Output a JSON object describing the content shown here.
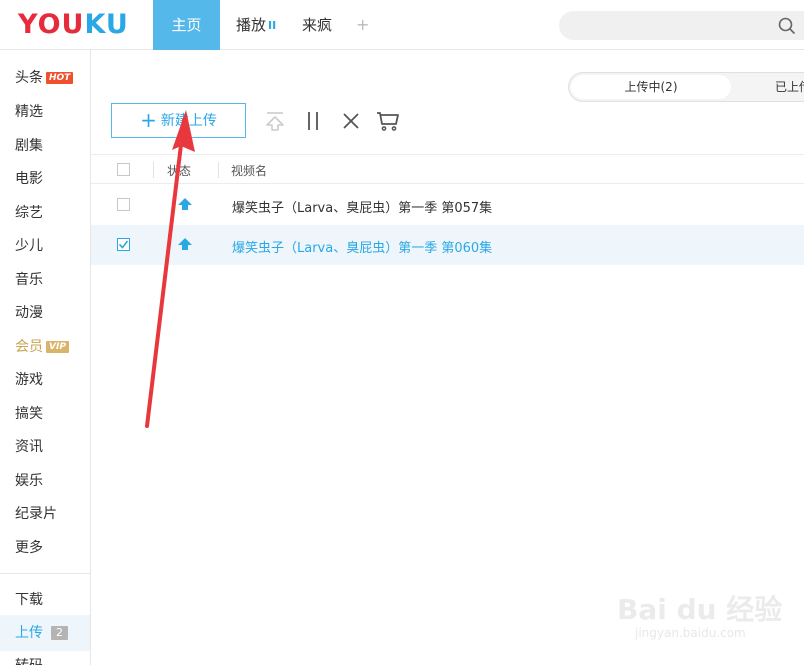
{
  "logo": {
    "part1": "YOU",
    "part2": "KU"
  },
  "nav": {
    "home": "主页",
    "play": "播放",
    "play_bars": "II",
    "laifeng": "来疯",
    "plus": "+"
  },
  "search": {
    "placeholder": ""
  },
  "sidebar": {
    "items": [
      {
        "label": "头条",
        "badge": "HOT"
      },
      {
        "label": "精选"
      },
      {
        "label": "剧集"
      },
      {
        "label": "电影"
      },
      {
        "label": "综艺"
      },
      {
        "label": "少儿"
      },
      {
        "label": "音乐"
      },
      {
        "label": "动漫"
      },
      {
        "label": "会员",
        "badge": "VIP"
      },
      {
        "label": "游戏"
      },
      {
        "label": "搞笑"
      },
      {
        "label": "资讯"
      },
      {
        "label": "娱乐"
      },
      {
        "label": "纪录片"
      },
      {
        "label": "更多"
      }
    ],
    "download": "下载",
    "upload": "上传",
    "upload_count": "2",
    "transcode": "转码"
  },
  "upload_tabs": {
    "active": "上传中(2)",
    "other": "已上传"
  },
  "toolbar": {
    "new_upload": "新建上传",
    "plus": "+"
  },
  "table": {
    "headers": {
      "status": "状态",
      "name": "视频名"
    },
    "rows": [
      {
        "title": "爆笑虫子（Larva、臭屁虫）第一季  第057集",
        "checked": false
      },
      {
        "title": "爆笑虫子（Larva、臭屁虫）第一季  第060集",
        "checked": true
      }
    ]
  },
  "watermark": {
    "main": "Bai du 经验",
    "sub": "jingyan.baidu.com"
  },
  "colors": {
    "accent": "#2aa8e6",
    "nav_active": "#55b8ea",
    "logo_red": "#e62b3c",
    "hot": "#f0502d",
    "vip": "#d9b46a",
    "arrow": "#e8383d"
  }
}
